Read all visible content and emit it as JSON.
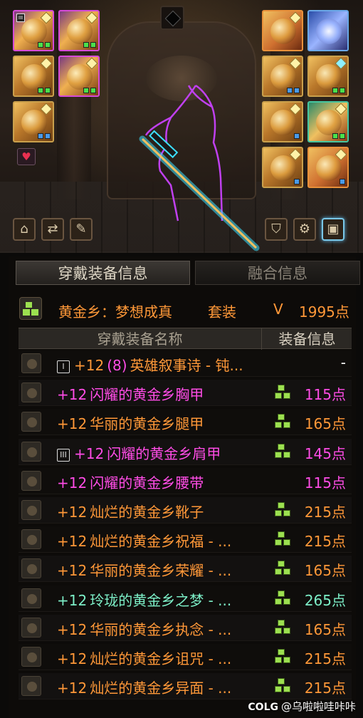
{
  "tabs": {
    "equip_info": "穿戴装备信息",
    "fusion_info": "融合信息"
  },
  "set": {
    "name": "黄金乡：梦想成真",
    "type": "套装",
    "rank": "V",
    "points": "1995点"
  },
  "table_header": {
    "name": "穿戴装备名称",
    "info": "装备信息"
  },
  "rows": [
    {
      "icon": "weapon-sword-icon",
      "badge": "I",
      "level": "+12",
      "refine": "(8)",
      "name": "英雄叙事诗 - 钝...",
      "points": "-",
      "color": "orange",
      "mark": false
    },
    {
      "icon": "chest-armor-icon",
      "badge": "",
      "level": "+12",
      "refine": "",
      "name": "闪耀的黄金乡胸甲",
      "points": "115点",
      "color": "pink",
      "mark": true
    },
    {
      "icon": "pants-icon",
      "badge": "",
      "level": "+12",
      "refine": "",
      "name": "华丽的黄金乡腿甲",
      "points": "165点",
      "color": "orange",
      "mark": true
    },
    {
      "icon": "shoulder-icon",
      "badge": "III",
      "level": "+12",
      "refine": "",
      "name": "闪耀的黄金乡肩甲",
      "points": "145点",
      "color": "pink",
      "mark": true
    },
    {
      "icon": "belt-icon",
      "badge": "",
      "level": "+12",
      "refine": "",
      "name": "闪耀的黄金乡腰带",
      "points": "115点",
      "color": "pink",
      "mark": false
    },
    {
      "icon": "boots-icon",
      "badge": "",
      "level": "+12",
      "refine": "",
      "name": "灿烂的黄金乡靴子",
      "points": "215点",
      "color": "orange",
      "mark": true
    },
    {
      "icon": "amulet-icon",
      "badge": "",
      "level": "+12",
      "refine": "",
      "name": "灿烂的黄金乡祝福 - ...",
      "points": "215点",
      "color": "orange",
      "mark": true
    },
    {
      "icon": "bracelet-icon",
      "badge": "",
      "level": "+12",
      "refine": "",
      "name": "华丽的黄金乡荣耀 - ...",
      "points": "165点",
      "color": "orange",
      "mark": true
    },
    {
      "icon": "ring-icon",
      "badge": "",
      "level": "+12",
      "refine": "",
      "name": "玲珑的黄金乡之梦 - ...",
      "points": "265点",
      "color": "green",
      "mark": true
    },
    {
      "icon": "support-icon",
      "badge": "",
      "level": "+12",
      "refine": "",
      "name": "华丽的黄金乡执念 - ...",
      "points": "165点",
      "color": "orange",
      "mark": true
    },
    {
      "icon": "magic-stone-icon",
      "badge": "",
      "level": "+12",
      "refine": "",
      "name": "灿烂的黄金乡诅咒 - ...",
      "points": "215点",
      "color": "orange",
      "mark": true
    },
    {
      "icon": "earring-icon",
      "badge": "",
      "level": "+12",
      "refine": "",
      "name": "灿烂的黄金乡异面 - ...",
      "points": "215点",
      "color": "orange",
      "mark": true
    }
  ],
  "watermark": {
    "site": "COLG",
    "user": "@乌啦啦哇咔咔"
  },
  "colors": {
    "pink": "#ff4ce6",
    "orange": "#ff9838",
    "green": "#7df0c8"
  }
}
